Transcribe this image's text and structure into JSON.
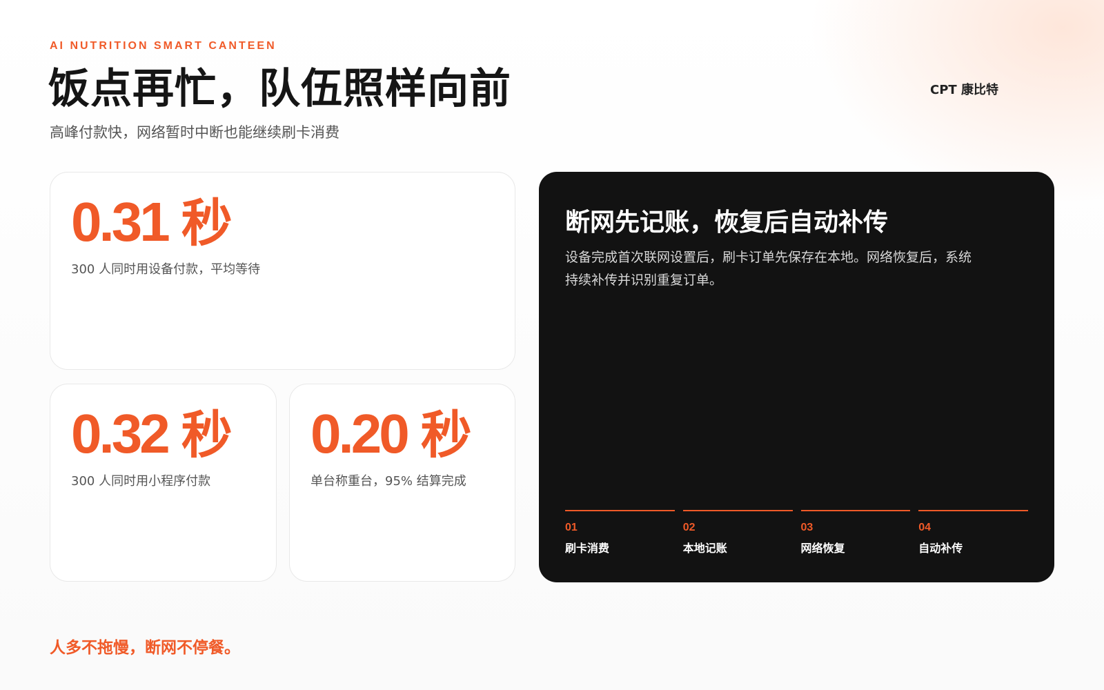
{
  "header": {
    "kicker": "AI NUTRITION SMART CANTEEN",
    "title": "饭点再忙，队伍照样向前",
    "subtitle": "高峰付款快，网络暂时中断也能继续刷卡消费",
    "brand": "CPT 康比特"
  },
  "metrics": [
    {
      "value": "0.31",
      "unit": "秒",
      "caption": "300 人同时用设备付款，平均等待"
    },
    {
      "value": "0.32",
      "unit": "秒",
      "caption": "300 人同时用小程序付款"
    },
    {
      "value": "0.20",
      "unit": "秒",
      "caption": "单台称重台，95% 结算完成"
    }
  ],
  "offline": {
    "title": "断网先记账，恢复后自动补传",
    "description": "设备完成首次联网设置后，刷卡订单先保存在本地。网络恢复后，系统持续补传并识别重复订单。",
    "steps": [
      {
        "num": "01",
        "label": "刷卡消费"
      },
      {
        "num": "02",
        "label": "本地记账"
      },
      {
        "num": "03",
        "label": "网络恢复"
      },
      {
        "num": "04",
        "label": "自动补传"
      }
    ]
  },
  "footer": {
    "tagline": "人多不拖慢，断网不停餐。"
  },
  "colors": {
    "accent": "#f05a28",
    "panel": "#121212",
    "card": "#ffffff",
    "text": "#151515",
    "muted": "#555555"
  }
}
